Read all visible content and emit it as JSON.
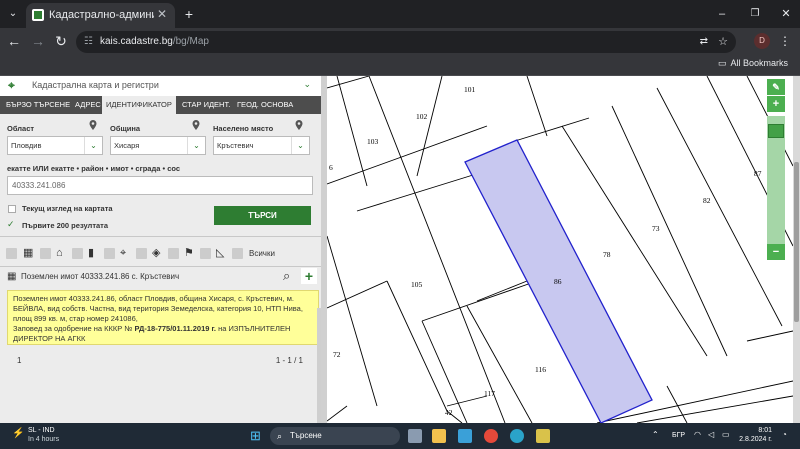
{
  "browser": {
    "tab_title": "Кадастрално-административн",
    "url_host": "kais.cadastre.bg",
    "url_path": "/bg/Map",
    "all_bookmarks": "All Bookmarks",
    "profile_initial": "D"
  },
  "panel": {
    "header_title": "Кадастрална карта и регистри",
    "tabs": [
      "БЪРЗО ТЪРСЕНЕ",
      "АДРЕС",
      "ИДЕНТИФИКАТОР",
      "СТАР ИДЕНТ.",
      "ГЕОД. ОСНОВА"
    ],
    "active_tab_index": 2,
    "oblast_label": "Област",
    "oblast_value": "Пловдив",
    "obshtina_label": "Община",
    "obshtina_value": "Хисаря",
    "naseleno_label": "Населено място",
    "naseleno_value": "Кръстевич",
    "ekatte_label": "екатте ИЛИ екатте • район • имот • сграда • сос",
    "ekatte_value": "40333.241.086",
    "current_view_label": "Текущ изглед на картата",
    "first200_label": "Първите 200 резултата",
    "first200_checked": true,
    "search_button": "ТЪРСИ",
    "layers_all_label": "Всички",
    "result_title": "Поземлен имот 40333.241.86 с. Кръстевич",
    "result_text_1": "Поземлен имот 40333.241.86, област Пловдив, община Хисаря, с. Кръстевич, м. БЕЙВЛА, вид собств. Частна, вид територия Земеделска, категория 10, НТП Нива, площ 899 кв. м, стар номер 241086,",
    "result_text_2_prefix": "Заповед за одобрение на КККР № ",
    "result_text_2_bold": "РД-18-775/01.11.2019 г.",
    "result_text_2_suffix": " на ИЗПЪЛНИТЕЛЕН ДИРЕКТОР НА АГКК",
    "pager_page": "1",
    "pager_range": "1 - 1 / 1"
  },
  "map": {
    "parcel_labels": [
      "101",
      "102",
      "103",
      "6",
      "87",
      "82",
      "73",
      "78",
      "86",
      "105",
      "72",
      "116",
      "117",
      "42"
    ],
    "highlight_color": "#c8c8f0",
    "highlight_border": "#2222cc"
  },
  "taskbar": {
    "weather_title": "SL - IND",
    "weather_sub": "In 4 hours",
    "search_placeholder": "Търсене",
    "lang": "БГР",
    "time": "8:01",
    "date": "2.8.2024 г."
  }
}
